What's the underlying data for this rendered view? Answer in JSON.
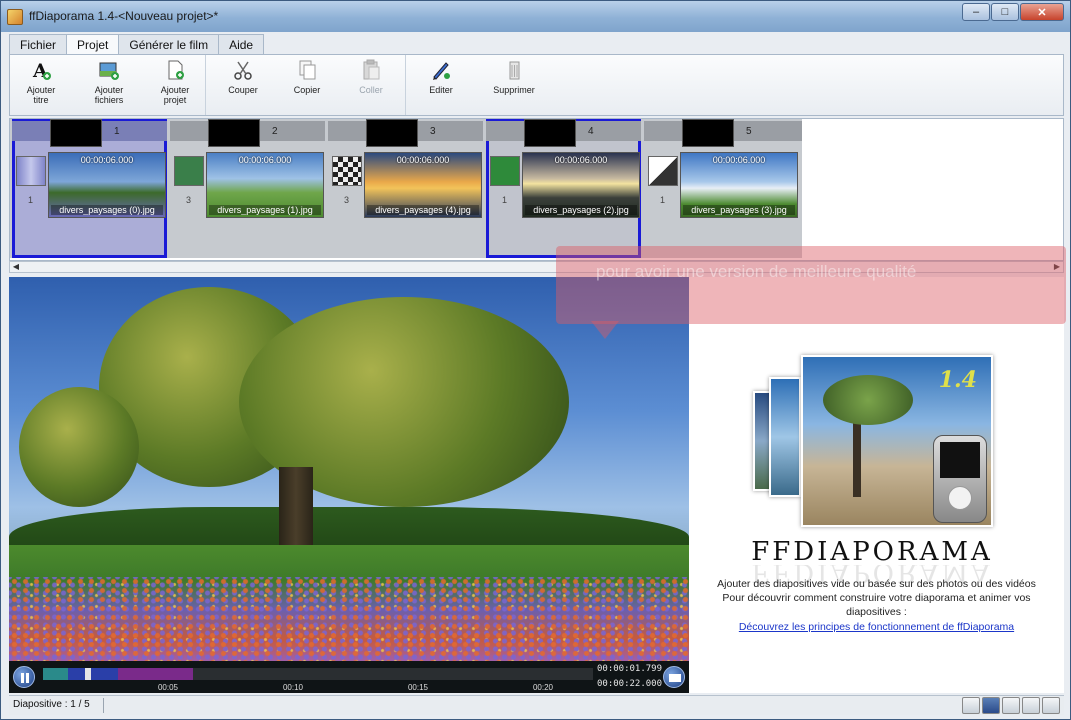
{
  "window": {
    "title": "ffDiaporama 1.4-<Nouveau projet>*"
  },
  "tabs": [
    {
      "label": "Fichier"
    },
    {
      "label": "Projet"
    },
    {
      "label": "Générer le film"
    },
    {
      "label": "Aide"
    }
  ],
  "ribbon": {
    "ajouter_titre": "Ajouter titre",
    "ajouter_fichiers": "Ajouter fichiers",
    "ajouter_projet": "Ajouter projet",
    "couper": "Couper",
    "copier": "Copier",
    "coller": "Coller",
    "editer": "Editer",
    "supprimer": "Supprimer"
  },
  "timeline": {
    "slides": [
      {
        "number": "1",
        "duration": "00:00:06.000",
        "filename": "divers_paysages (0).jpg",
        "transition": "1"
      },
      {
        "number": "2",
        "duration": "00:00:06.000",
        "filename": "divers_paysages (1).jpg",
        "transition": "3"
      },
      {
        "number": "3",
        "duration": "00:00:06.000",
        "filename": "divers_paysages (4).jpg",
        "transition": "3"
      },
      {
        "number": "4",
        "duration": "00:00:06.000",
        "filename": "divers_paysages (2).jpg",
        "transition": "1"
      },
      {
        "number": "5",
        "duration": "00:00:06.000",
        "filename": "divers_paysages (3).jpg",
        "transition": "1"
      }
    ]
  },
  "hint": {
    "text": "pour avoir une version de meilleure qualité"
  },
  "player": {
    "ticks": [
      "00:05",
      "00:10",
      "00:15",
      "00:20"
    ],
    "current_time": "00:00:01.799",
    "total_time": "00:00:22.000",
    "position_fraction": 0.082
  },
  "info": {
    "logo": "FFDIAPORAMA",
    "version": "1.4",
    "line1": "Ajouter des diapositives vide ou basée sur des photos ou des vidéos",
    "line2": "Pour découvrir comment construire votre diaporama et animer vos diapositives :",
    "link": "Découvrez les principes de fonctionnement de ffDiaporama"
  },
  "status": {
    "text": "Diapositive : 1 / 5"
  }
}
